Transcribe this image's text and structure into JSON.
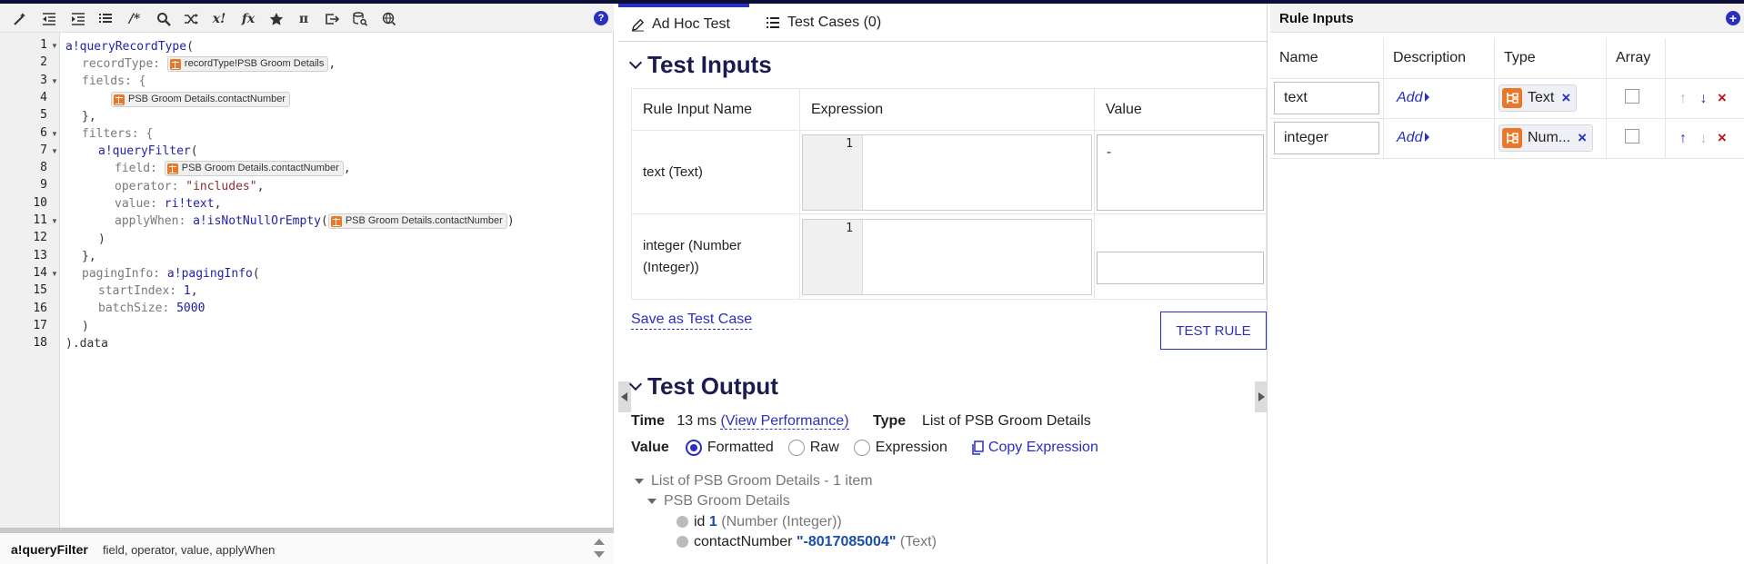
{
  "editor": {
    "line_numbers": [
      "1",
      "2",
      "3",
      "4",
      "5",
      "6",
      "7",
      "8",
      "9",
      "10",
      "11",
      "12",
      "13",
      "14",
      "15",
      "16",
      "17",
      "18"
    ],
    "code": {
      "l1_fn": "a!queryRecordType",
      "l1_rest": "(",
      "l2_key": "recordType: ",
      "l2_pill": "recordType!PSB Groom Details",
      "l2_end": ",",
      "l3_key": "fields: {",
      "l4_pill": "PSB Groom Details.contactNumber",
      "l5": "},",
      "l6_key": "filters: {",
      "l7_fn": "a!queryFilter",
      "l7_rest": "(",
      "l8_key": "field: ",
      "l8_pill": "PSB Groom Details.contactNumber",
      "l8_end": ",",
      "l9_key": "operator: ",
      "l9_val": "\"includes\"",
      "l9_end": ",",
      "l10_key": "value: ",
      "l10_val": "ri!text",
      "l10_end": ",",
      "l11_key": "applyWhen: ",
      "l11_fn": "a!isNotNullOrEmpty",
      "l11_open": "(",
      "l11_pill": "PSB Groom Details.contactNumber",
      "l11_close": ")",
      "l12": ")",
      "l13": "},",
      "l14_key": "pagingInfo: ",
      "l14_fn": "a!pagingInfo",
      "l14_rest": "(",
      "l15_key": "startIndex: ",
      "l15_val": "1",
      "l15_end": ",",
      "l16_key": "batchSize: ",
      "l16_val": "5000",
      "l17": ")",
      "l18": ").data"
    },
    "hint": {
      "function": "a!queryFilter",
      "params": "field, operator, value, applyWhen"
    },
    "toolbar_text": {
      "comment": "/*",
      "xbang": "x!",
      "fx": "fx",
      "pi": "π"
    },
    "help": "?"
  },
  "test": {
    "tabs": [
      {
        "label": "Ad Hoc Test"
      },
      {
        "label": "Test Cases (0)"
      }
    ],
    "inputs_title": "Test Inputs",
    "table_headers": [
      "Rule Input Name",
      "Expression",
      "Value"
    ],
    "rows": [
      {
        "name": "text (Text)",
        "line": "1",
        "value": "-"
      },
      {
        "name_line1": "integer (Number",
        "name_line2": "(Integer))",
        "line": "1",
        "value": ""
      }
    ],
    "save_link": "Save as Test Case",
    "test_button": "TEST RULE",
    "output_title": "Test Output",
    "time_label": "Time",
    "time_value": "13 ms",
    "view_perf": "(View Performance)",
    "type_label": "Type",
    "type_value": "List of PSB Groom Details",
    "value_label": "Value",
    "radio_options": [
      {
        "label": "Formatted",
        "selected": true
      },
      {
        "label": "Raw",
        "selected": false
      },
      {
        "label": "Expression",
        "selected": false
      }
    ],
    "copy_expression": "Copy Expression",
    "tree": {
      "root": "List of PSB Groom Details - 1 item",
      "child": "PSB Groom Details",
      "field1_name": "id",
      "field1_value": "1",
      "field1_type": "(Number (Integer))",
      "field2_name": "contactNumber",
      "field2_value": "\"-8017085004\"",
      "field2_type": "(Text)"
    }
  },
  "rule_inputs": {
    "title": "Rule Inputs",
    "add": "+",
    "headers": [
      "Name",
      "Description",
      "Type",
      "Array"
    ],
    "rows": [
      {
        "name": "text",
        "description_link": "Add",
        "type": "Text",
        "up_enabled": false,
        "down_enabled": true
      },
      {
        "name": "integer",
        "description_link": "Add",
        "type": "Num...",
        "up_enabled": true,
        "down_enabled": false
      }
    ],
    "remove": "×",
    "delete": "×",
    "up": "↑",
    "down": "↓"
  },
  "colors": {
    "accent": "#2b2fc1",
    "record_icon": "#e8782a",
    "delete": "#c0141e",
    "heading": "#1b1b50"
  }
}
